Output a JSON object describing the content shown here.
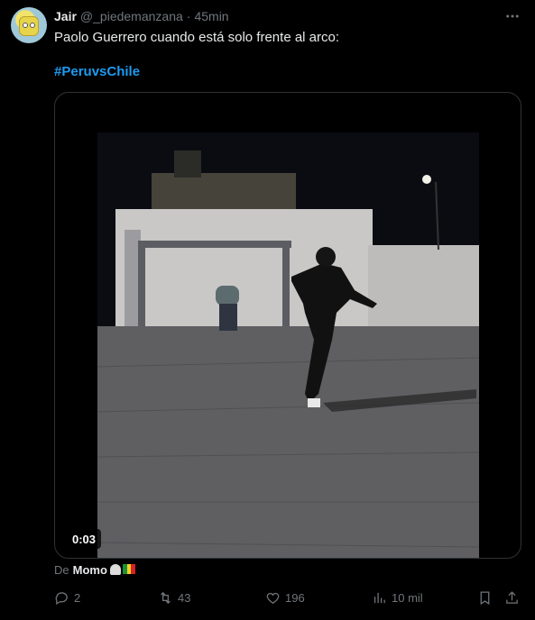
{
  "tweet": {
    "display_name": "Jair",
    "handle": "@_piedemanzana",
    "separator": "·",
    "time": "45min",
    "text": "Paolo Guerrero cuando está solo frente al arco:",
    "hashtag": "#PeruvsChile"
  },
  "media": {
    "duration": "0:03"
  },
  "attribution": {
    "prefix": "De",
    "name": "Momo"
  },
  "actions": {
    "replies": "2",
    "retweets": "43",
    "likes": "196",
    "views": "10 mil"
  },
  "icons": {
    "more": "more-horizontal-icon",
    "reply": "reply-icon",
    "retweet": "retweet-icon",
    "like": "heart-icon",
    "views": "views-chart-icon",
    "bookmark": "bookmark-icon",
    "share": "share-icon"
  },
  "colors": {
    "background": "#000000",
    "text": "#e7e9ea",
    "muted": "#71767b",
    "link": "#1d9bf0",
    "border": "#2f3336"
  }
}
